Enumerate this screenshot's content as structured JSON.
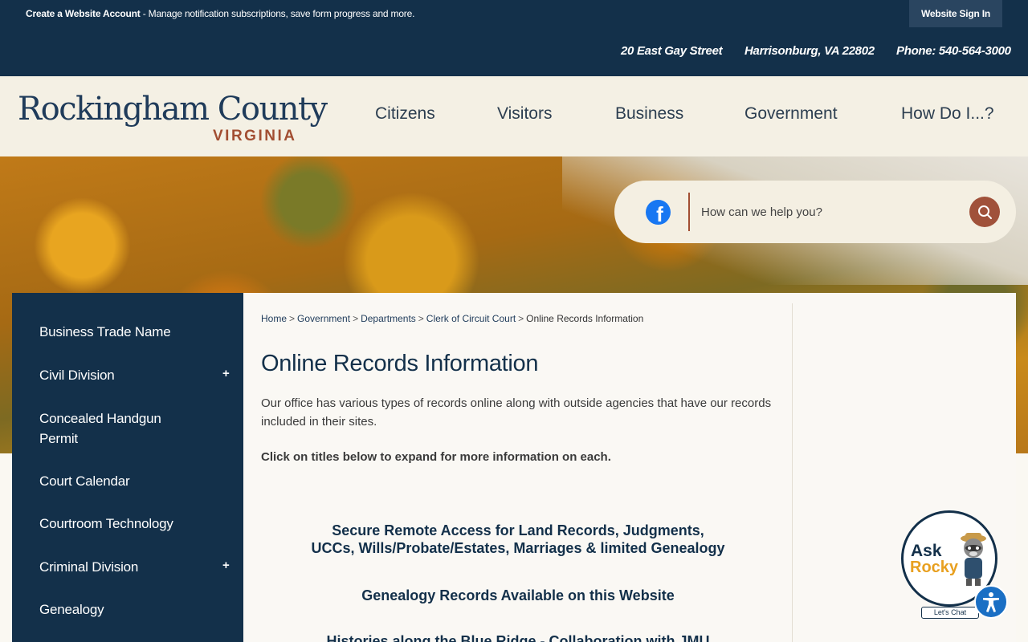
{
  "utility_bar": {
    "create_account_label": "Create a Website Account",
    "create_account_text": " - Manage notification subscriptions, save form progress and more.",
    "sign_in_label": "Website Sign In"
  },
  "contact": {
    "street": "20 East Gay Street",
    "city": "Harrisonburg, VA 22802",
    "phone": "Phone: 540-564-3000"
  },
  "logo": {
    "main": "Rockingham County",
    "sub": "VIRGINIA"
  },
  "nav": [
    "Citizens",
    "Visitors",
    "Business",
    "Government",
    "How Do I...?"
  ],
  "search": {
    "placeholder": "How can we help you?",
    "icon": "search-icon",
    "social_icon": "facebook-icon"
  },
  "sidebar": {
    "items": [
      {
        "label": "Business Trade Name",
        "expandable": false
      },
      {
        "label": "Civil Division",
        "expandable": true
      },
      {
        "label": "Concealed Handgun Permit",
        "expandable": false
      },
      {
        "label": "Court Calendar",
        "expandable": false
      },
      {
        "label": "Courtroom Technology",
        "expandable": false
      },
      {
        "label": "Criminal Division",
        "expandable": true
      },
      {
        "label": "Genealogy",
        "expandable": false
      }
    ],
    "expand_symbol": "+"
  },
  "breadcrumb": [
    {
      "label": "Home"
    },
    {
      "label": "Government"
    },
    {
      "label": "Departments"
    },
    {
      "label": "Clerk of Circuit Court"
    },
    {
      "label": "Online Records Information"
    }
  ],
  "breadcrumb_separator": ">",
  "page": {
    "title": "Online Records Information",
    "intro": "Our office has various types of records online along with outside agencies that have our records included in their sites.",
    "instruction": "Click on titles below to expand for more information on each.",
    "accordion_titles": [
      "Secure Remote Access for Land Records, Judgments, UCCs, Wills/Probate/Estates, Marriages & limited Genealogy",
      "Genealogy Records Available on this Website",
      "Histories along the Blue Ridge - Collaboration with JMU"
    ]
  },
  "chat": {
    "ask": "Ask",
    "rocky": "Rocky",
    "button_label": "Let's Chat"
  },
  "accessibility": {
    "icon": "accessibility-icon"
  },
  "colors": {
    "navy": "#13304a",
    "accent_rust": "#a24e32",
    "cream": "#f4f0e4",
    "facebook_blue": "#1877f2",
    "chat_gold": "#e8a020"
  }
}
